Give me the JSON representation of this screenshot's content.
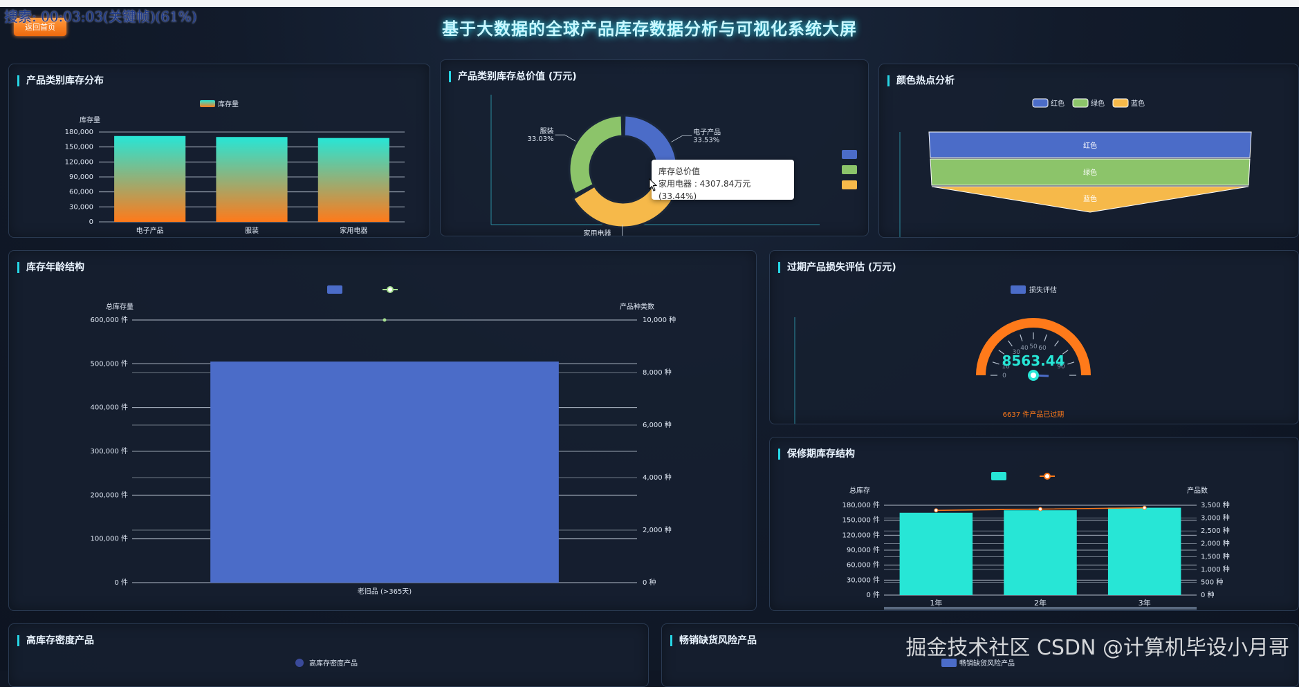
{
  "overlay": {
    "search_status": "搜索: 00:03:03(关键帧)(61%)"
  },
  "header": {
    "back_label": "返回首页",
    "title": "基于大数据的全球产品库存数据分析与可视化系统大屏"
  },
  "panels": {
    "p1": {
      "title": "产品类别库存分布",
      "legend": "库存量",
      "ylabel": "库存量"
    },
    "p2": {
      "title": "产品类别库存总价值 (万元)"
    },
    "p3": {
      "title": "颜色热点分析",
      "legend": [
        "红色",
        "绿色",
        "蓝色"
      ]
    },
    "p4": {
      "title": "库存年龄结构",
      "yleft": "总库存量",
      "yright": "产品种类数"
    },
    "p5": {
      "title": "过期产品损失评估 (万元)",
      "legend": "损失评估",
      "value": "8563.44",
      "note": "6637 件产品已过期"
    },
    "p6": {
      "title": "保修期库存结构",
      "yleft": "总库存",
      "yright": "产品数"
    },
    "p7": {
      "title": "高库存密度产品",
      "legend": "高库存密度产品"
    },
    "p8": {
      "title": "畅销缺货风险产品",
      "legend": "畅销缺货风险产品"
    }
  },
  "tooltip": {
    "title": "库存总价值",
    "line": "家用电器 : 4307.84万元 (33.44%)"
  },
  "watermark": "CSDN @计算机毕设小月哥",
  "watermark_left": "掘金技术社区",
  "colors": {
    "cyan": "#27e6d6",
    "orange": "#ff7a1a",
    "blue": "#4b6cc8",
    "green": "#8cc46a",
    "yellow": "#f6b94a"
  },
  "chart_data": [
    {
      "type": "bar",
      "title": "产品类别库存分布",
      "categories": [
        "电子产品",
        "服装",
        "家用电器"
      ],
      "series": [
        {
          "name": "库存量",
          "values": [
            172000,
            170000,
            168000
          ]
        }
      ],
      "ylabel": "库存量",
      "ylim": [
        0,
        180000
      ],
      "yticks": [
        "0",
        "30,000",
        "60,000",
        "90,000",
        "120,000",
        "150,000",
        "180,000"
      ]
    },
    {
      "type": "pie",
      "title": "产品类别库存总价值 (万元)",
      "labels": [
        "电子产品",
        "服装",
        "家用电器"
      ],
      "values": [
        33.53,
        33.03,
        33.44
      ],
      "label_text": [
        "电子产品\n33.53%",
        "服装\n33.03%",
        "家用电器"
      ]
    },
    {
      "type": "bar",
      "title": "颜色热点分析",
      "categories": [
        "红色",
        "绿色",
        "蓝色"
      ],
      "values": [
        3,
        2,
        1
      ],
      "note": "funnel"
    },
    {
      "type": "bar",
      "title": "库存年龄结构",
      "categories": [
        "老旧品 (>365天)"
      ],
      "series": [
        {
          "name": "总库存量",
          "values": [
            505000
          ]
        },
        {
          "name": "产品种类数",
          "values": [
            10000
          ]
        }
      ],
      "ylim": [
        0,
        600000
      ],
      "yticks": [
        "0 件",
        "100,000 件",
        "200,000 件",
        "300,000 件",
        "400,000 件",
        "500,000 件",
        "600,000 件"
      ],
      "y2lim": [
        0,
        10000
      ],
      "y2ticks": [
        "0 种",
        "2,000 种",
        "4,000 种",
        "6,000 种",
        "8,000 种",
        "10,000 种"
      ]
    },
    {
      "type": "bar",
      "title": "过期产品损失评估 (万元)",
      "categories": [
        "损失评估"
      ],
      "values": [
        8563.44
      ],
      "note": "gauge",
      "ticks": [
        "0",
        "10",
        "30",
        "40",
        "50",
        "60",
        "90"
      ]
    },
    {
      "type": "bar",
      "title": "保修期库存结构",
      "categories": [
        "1年",
        "2年",
        "3年"
      ],
      "series": [
        {
          "name": "总库存",
          "values": [
            165000,
            170000,
            175000
          ]
        },
        {
          "name": "产品数",
          "values": [
            3300,
            3350,
            3400
          ]
        }
      ],
      "ylim": [
        0,
        180000
      ],
      "yticks": [
        "0 件",
        "30,000 件",
        "60,000 件",
        "90,000 件",
        "120,000 件",
        "150,000 件",
        "180,000 件"
      ],
      "y2lim": [
        0,
        3500
      ],
      "y2ticks": [
        "0 种",
        "500 种",
        "1,000 种",
        "1,500 种",
        "2,000 种",
        "2,500 种",
        "3,000 种",
        "3,500 种"
      ]
    }
  ]
}
